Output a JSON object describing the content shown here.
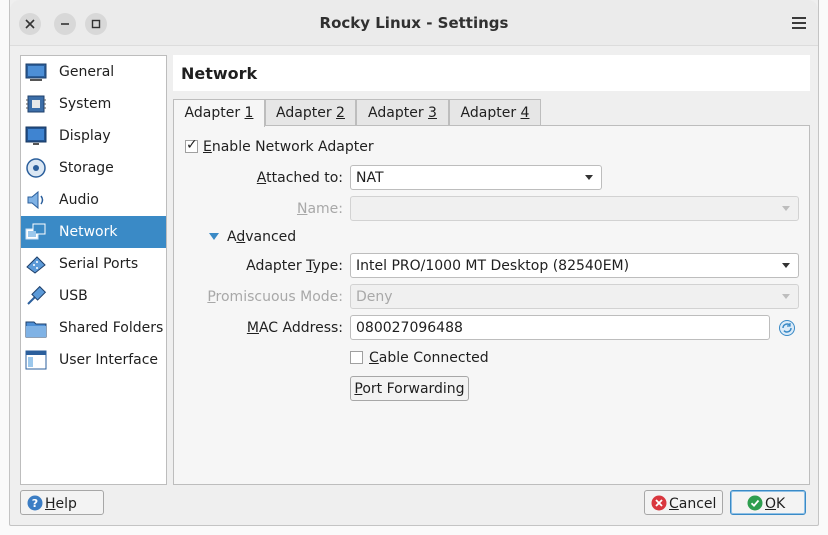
{
  "window": {
    "title": "Rocky Linux - Settings"
  },
  "sidebar": {
    "items": [
      {
        "label": "General",
        "icon": "general-icon"
      },
      {
        "label": "System",
        "icon": "system-icon"
      },
      {
        "label": "Display",
        "icon": "display-icon"
      },
      {
        "label": "Storage",
        "icon": "storage-icon"
      },
      {
        "label": "Audio",
        "icon": "audio-icon"
      },
      {
        "label": "Network",
        "icon": "network-icon",
        "selected": true
      },
      {
        "label": "Serial Ports",
        "icon": "serial-ports-icon"
      },
      {
        "label": "USB",
        "icon": "usb-icon"
      },
      {
        "label": "Shared Folders",
        "icon": "shared-folders-icon"
      },
      {
        "label": "User Interface",
        "icon": "user-interface-icon"
      }
    ]
  },
  "header": {
    "title": "Network"
  },
  "tabs": [
    {
      "label_pre": "Adapter ",
      "label_key": "1"
    },
    {
      "label_pre": "Adapter ",
      "label_key": "2"
    },
    {
      "label_pre": "Adapter ",
      "label_key": "3"
    },
    {
      "label_pre": "Adapter ",
      "label_key": "4"
    }
  ],
  "active_tab": "Adapter 1",
  "adapter": {
    "enable_label_key": "E",
    "enable_label_rest": "nable Network Adapter",
    "enabled": true,
    "attached_label_key": "A",
    "attached_label_rest": "ttached to:",
    "attached_value": "NAT",
    "name_label_key": "N",
    "name_label_rest": "ame:",
    "name_value": "",
    "advanced_label_pre": "A",
    "advanced_label_key": "d",
    "advanced_label_rest": "vanced",
    "adapter_type_label_pre": "Adapter ",
    "adapter_type_label_key": "T",
    "adapter_type_label_rest": "ype:",
    "adapter_type_value": "Intel PRO/1000 MT Desktop (82540EM)",
    "promiscuous_label_key": "P",
    "promiscuous_label_rest": "romiscuous Mode:",
    "promiscuous_value": "Deny",
    "mac_label_key": "M",
    "mac_label_rest": "AC Address:",
    "mac_value": "080027096488",
    "cable_label_key": "C",
    "cable_label_rest": "able Connected",
    "cable_connected": false,
    "port_forwarding_key": "P",
    "port_forwarding_rest": "ort Forwarding"
  },
  "footer": {
    "help_key": "H",
    "help_rest": "elp",
    "cancel_pre": "",
    "cancel_key": "C",
    "cancel_rest": "ancel",
    "ok_key": "O",
    "ok_rest": "K"
  },
  "colors": {
    "selection": "#3a8ac6",
    "help": "#3b7dc4",
    "cancel": "#d9363e",
    "ok": "#2e9e4f"
  }
}
